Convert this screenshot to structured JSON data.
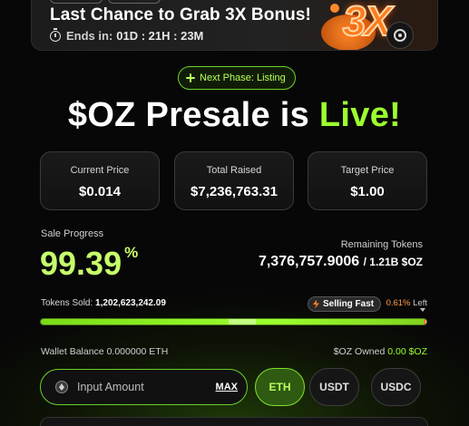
{
  "promo": {
    "title": "Last Chance to Grab 3X Bonus!",
    "timer_label": "Ends in:",
    "timer_value": "01D : 21H : 23M",
    "badge_text": "3X"
  },
  "phase_label": "Next Phase: Listing",
  "headline": {
    "main": "$OZ Presale is",
    "accent": "Live!"
  },
  "stats": [
    {
      "label": "Current Price",
      "value": "$0.014"
    },
    {
      "label": "Total Raised",
      "value": "$7,236,763.31"
    },
    {
      "label": "Target Price",
      "value": "$1.00"
    }
  ],
  "sale": {
    "label": "Sale Progress",
    "percent": "99.39",
    "percent_sign": "%",
    "remaining_label": "Remaining Tokens",
    "remaining_value": "7,376,757.9006",
    "remaining_total": "/ 1.21B $OZ"
  },
  "progress": {
    "sold_label": "Tokens Sold:",
    "sold_value": "1,202,623,242.09",
    "fast_label": "Selling Fast",
    "left_percent": "0.61%",
    "left_label": "Left",
    "fill_fraction": 0.9939
  },
  "wallet": {
    "balance_label": "Wallet Balance",
    "balance_value": "0.000000 ETH",
    "owned_label": "$OZ Owned",
    "owned_value": "0.00 $OZ"
  },
  "input": {
    "placeholder": "Input Amount",
    "max_label": "MAX"
  },
  "currencies": [
    "ETH",
    "USDT",
    "USDC"
  ],
  "colors": {
    "accent": "#9cff2e",
    "orange": "#ff7a1a",
    "bg": "#070707"
  }
}
